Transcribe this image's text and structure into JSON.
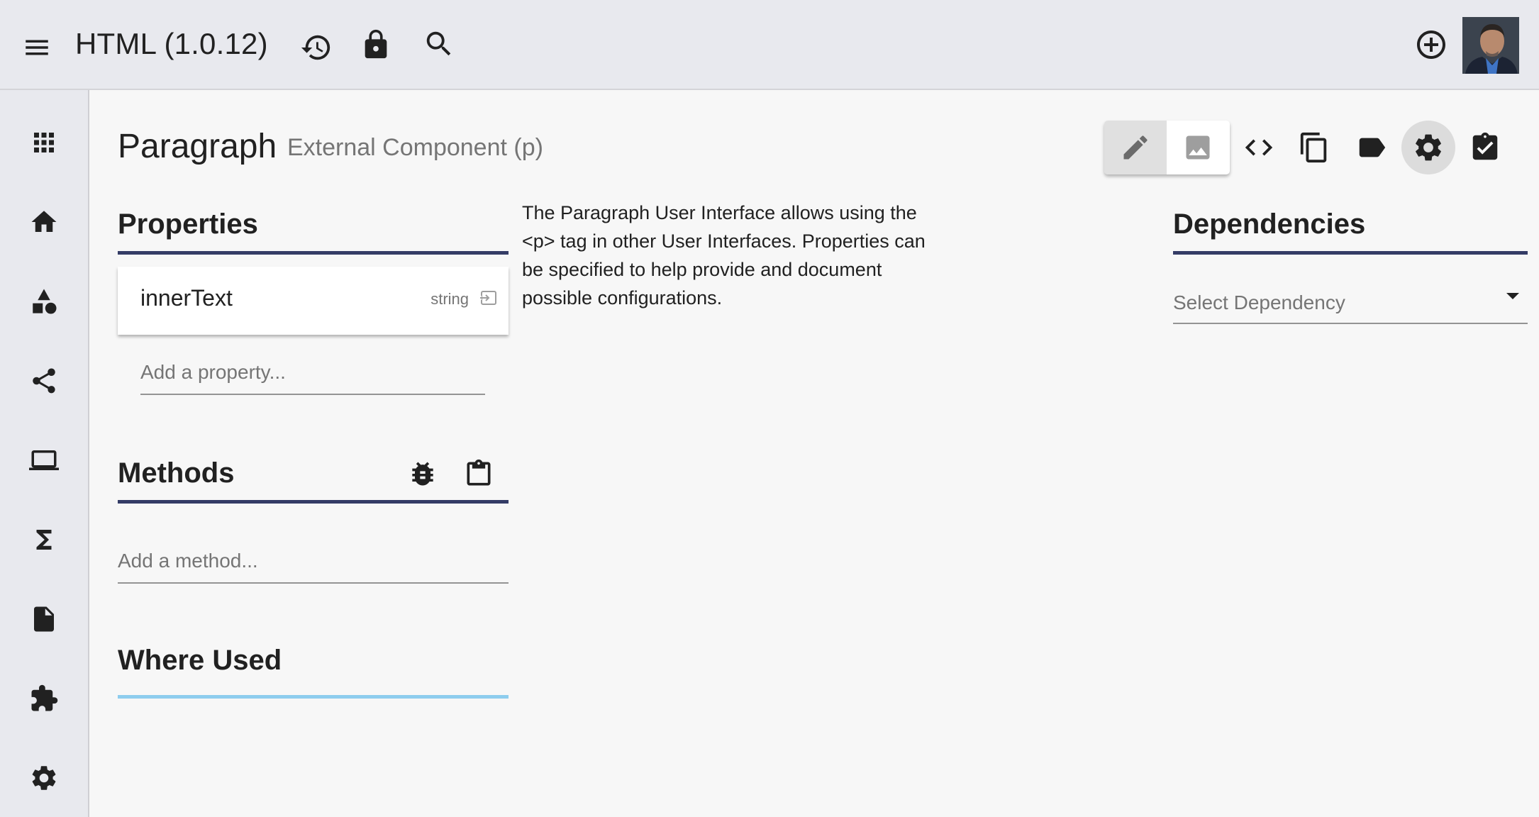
{
  "header": {
    "app_title": "HTML (1.0.12)",
    "icons": [
      "menu-icon",
      "history-icon",
      "lock-icon",
      "search-icon"
    ],
    "right_icons": [
      "add-circle-icon"
    ],
    "avatar_alt": "User avatar"
  },
  "sidebar": {
    "items": [
      {
        "name": "apps",
        "icon": "apps-grid-icon"
      },
      {
        "name": "home",
        "icon": "home-icon"
      },
      {
        "name": "components",
        "icon": "shapes-icon"
      },
      {
        "name": "share",
        "icon": "share-icon"
      },
      {
        "name": "interfaces",
        "icon": "laptop-icon"
      },
      {
        "name": "functions",
        "icon": "sigma-icon"
      },
      {
        "name": "documents",
        "icon": "file-icon"
      },
      {
        "name": "extensions",
        "icon": "puzzle-icon"
      },
      {
        "name": "settings",
        "icon": "gear-icon"
      }
    ]
  },
  "page": {
    "title": "Paragraph",
    "subtitle": "External Component (p)",
    "description": "The Paragraph User Interface allows using the <p> tag in other User Interfaces. Properties can be specified to help provide and document possible configurations."
  },
  "toolbar": {
    "view_toggle": [
      {
        "name": "edit",
        "icon": "pencil-icon",
        "active": true
      },
      {
        "name": "preview",
        "icon": "image-icon",
        "active": false
      }
    ],
    "actions": [
      {
        "name": "code",
        "icon": "code-icon"
      },
      {
        "name": "copy",
        "icon": "copy-icon"
      },
      {
        "name": "label",
        "icon": "label-icon"
      },
      {
        "name": "settings",
        "icon": "gear-icon",
        "active": true
      },
      {
        "name": "checklist",
        "icon": "clipboard-check-icon"
      }
    ]
  },
  "properties": {
    "heading": "Properties",
    "items": [
      {
        "name": "innerText",
        "type": "string"
      }
    ],
    "add_placeholder": "Add a property...",
    "add_value": ""
  },
  "methods": {
    "heading": "Methods",
    "add_placeholder": "Add a method...",
    "add_value": ""
  },
  "where_used": {
    "heading": "Where Used"
  },
  "dependencies": {
    "heading": "Dependencies",
    "select_placeholder": "Select Dependency"
  },
  "colors": {
    "header_bg": "#e8e9ee",
    "page_bg": "#f7f7f7",
    "section_underline": "#343c66",
    "where_used_underline": "#8ecdee",
    "text_primary": "#212121",
    "text_secondary": "#757575"
  }
}
